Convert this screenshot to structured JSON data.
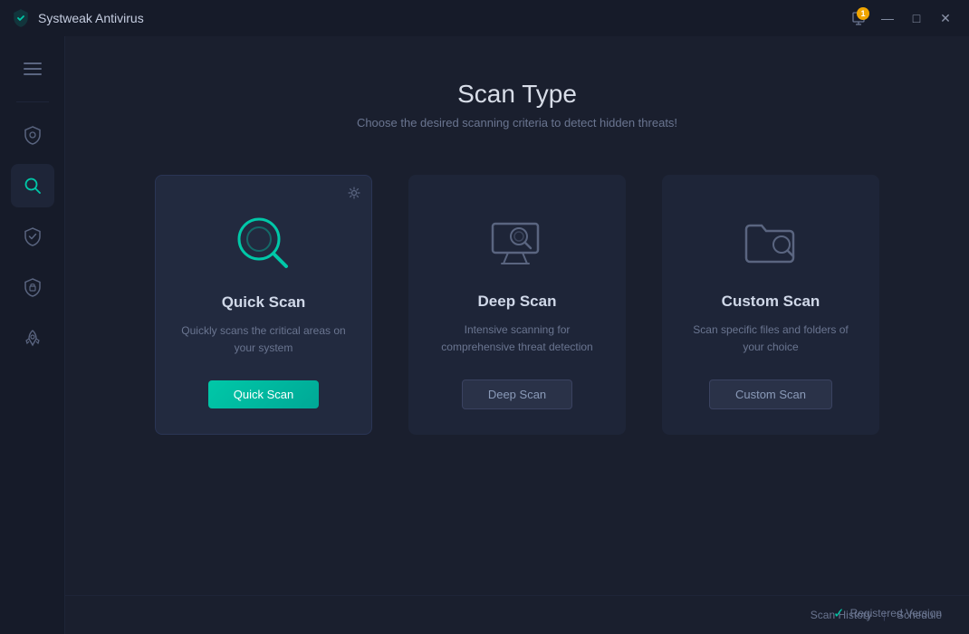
{
  "titlebar": {
    "app_name": "Systweak Antivirus",
    "notification_count": "1",
    "controls": {
      "minimize": "—",
      "maximize": "□",
      "close": "✕"
    }
  },
  "sidebar": {
    "items": [
      {
        "id": "menu",
        "icon": "≡",
        "label": "Menu",
        "active": false
      },
      {
        "id": "protection",
        "icon": "shield",
        "label": "Protection",
        "active": false
      },
      {
        "id": "scan",
        "icon": "search",
        "label": "Scan",
        "active": true
      },
      {
        "id": "safety",
        "icon": "shield-check",
        "label": "Safety",
        "active": false
      },
      {
        "id": "secure",
        "icon": "shield-lock",
        "label": "Secure",
        "active": false
      },
      {
        "id": "boost",
        "icon": "rocket",
        "label": "Boost",
        "active": false
      }
    ]
  },
  "page": {
    "title": "Scan Type",
    "subtitle": "Choose the desired scanning criteria to detect hidden threats!"
  },
  "scan_cards": [
    {
      "id": "quick",
      "title": "Quick Scan",
      "description": "Quickly scans the critical areas on your system",
      "button_label": "Quick Scan",
      "button_type": "primary",
      "has_settings": true
    },
    {
      "id": "deep",
      "title": "Deep Scan",
      "description": "Intensive scanning for comprehensive threat detection",
      "button_label": "Deep Scan",
      "button_type": "secondary",
      "has_settings": false
    },
    {
      "id": "custom",
      "title": "Custom Scan",
      "description": "Scan specific files and folders of your choice",
      "button_label": "Custom Scan",
      "button_type": "secondary",
      "has_settings": false
    }
  ],
  "footer": {
    "scan_history_label": "Scan History",
    "divider": "|",
    "schedule_label": "Schedule",
    "registered_label": "Registered Version"
  }
}
